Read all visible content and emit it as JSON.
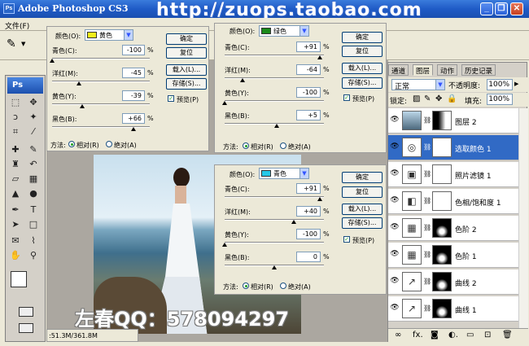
{
  "app": {
    "title": "Adobe Photoshop CS3",
    "watermark_url": "http://zuops.taobao.com",
    "ps_logo": "Ps",
    "win_buttons": [
      "_",
      "❐",
      "✕"
    ]
  },
  "menu": {
    "file": "文件(F)"
  },
  "status": {
    "text": ":51.3M/361.8M"
  },
  "watermark_qq": "左春QQ：578094297",
  "dialog1": {
    "color_label": "颜色(O):",
    "color_value": "黄色",
    "swatch": "#f2ee1a",
    "rows": [
      {
        "label": "青色(C):",
        "value": "-100",
        "pct": "%",
        "level": 0.0
      },
      {
        "label": "洋红(M):",
        "value": "-45",
        "pct": "%",
        "level": 0.275
      },
      {
        "label": "黄色(Y):",
        "value": "-39",
        "pct": "%",
        "level": 0.305
      },
      {
        "label": "黑色(B):",
        "value": "+66",
        "pct": "%",
        "level": 0.83
      }
    ],
    "buttons": [
      "确定",
      "复位",
      "载入(L)...",
      "存储(S)..."
    ],
    "preview": "预览(P)",
    "method": "方法:",
    "relative": "相对(R)",
    "absolute": "绝对(A)"
  },
  "dialog2": {
    "color_label": "颜色(O):",
    "color_value": "绿色",
    "swatch": "#1a8a1a",
    "rows": [
      {
        "label": "青色(C):",
        "value": "+91",
        "pct": "%",
        "level": 0.955
      },
      {
        "label": "洋红(M):",
        "value": "-64",
        "pct": "%",
        "level": 0.18
      },
      {
        "label": "黄色(Y):",
        "value": "-100",
        "pct": "%",
        "level": 0.0
      },
      {
        "label": "黑色(B):",
        "value": "+5",
        "pct": "%",
        "level": 0.525
      }
    ],
    "buttons": [
      "确定",
      "复位",
      "载入(L)...",
      "存储(S)..."
    ],
    "preview": "预览(P)",
    "method": "方法:",
    "relative": "相对(R)",
    "absolute": "绝对(A)"
  },
  "dialog3": {
    "color_label": "颜色(O):",
    "color_value": "青色",
    "swatch": "#25c8e8",
    "rows": [
      {
        "label": "青色(C):",
        "value": "+91",
        "pct": "%",
        "level": 0.955
      },
      {
        "label": "洋红(M):",
        "value": "+40",
        "pct": "%",
        "level": 0.7
      },
      {
        "label": "黄色(Y):",
        "value": "-100",
        "pct": "%",
        "level": 0.0
      },
      {
        "label": "黑色(B):",
        "value": "0",
        "pct": "%",
        "level": 0.5
      }
    ],
    "buttons": [
      "确定",
      "复位",
      "载入(L)...",
      "存储(S)..."
    ],
    "preview": "预览(P)",
    "method": "方法:",
    "relative": "相对(R)",
    "absolute": "绝对(A)"
  },
  "layers_panel": {
    "tabs": [
      "通道",
      "图层",
      "动作",
      "历史记录"
    ],
    "blend_mode": "正常",
    "opacity_label": "不透明度:",
    "opacity": "100%",
    "lock_label": "锁定:",
    "fill_label": "填充:",
    "fill": "100%",
    "layers": [
      "图层 2",
      "选取颜色 1",
      "照片滤镜 1",
      "色相/饱和度 1",
      "色阶 2",
      "色阶 1",
      "曲线 2",
      "曲线 1"
    ],
    "footer_icons": [
      "∞",
      "fx.",
      "◙",
      "◐.",
      "▭",
      "⊡",
      "🗑"
    ]
  }
}
